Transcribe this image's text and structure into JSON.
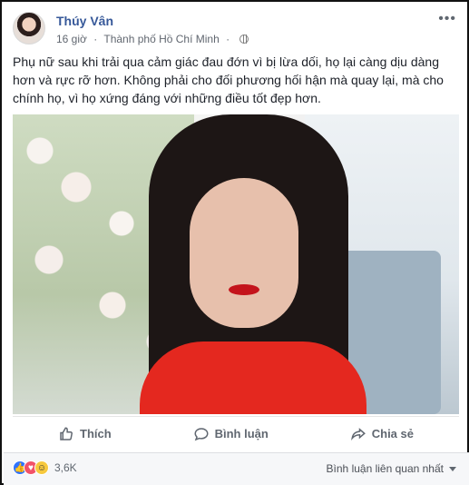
{
  "post": {
    "author_name": "Thúy Vân",
    "time": "16 giờ",
    "location": "Thành phố Hồ Chí Minh",
    "privacy_icon": "globe-icon",
    "text": "Phụ nữ sau khi trải qua cảm giác đau đớn vì bị lừa dối, họ lại càng dịu dàng hơn và rực rỡ hơn. Không phải cho đối phương hối hận mà quay lại, mà cho chính họ, vì họ xứng đáng với những điều tốt đẹp hơn."
  },
  "actions": {
    "like_label": "Thích",
    "comment_label": "Bình luận",
    "share_label": "Chia sẻ"
  },
  "footer": {
    "reaction_count": "3,6K",
    "sort_label": "Bình luận liên quan nhất"
  }
}
